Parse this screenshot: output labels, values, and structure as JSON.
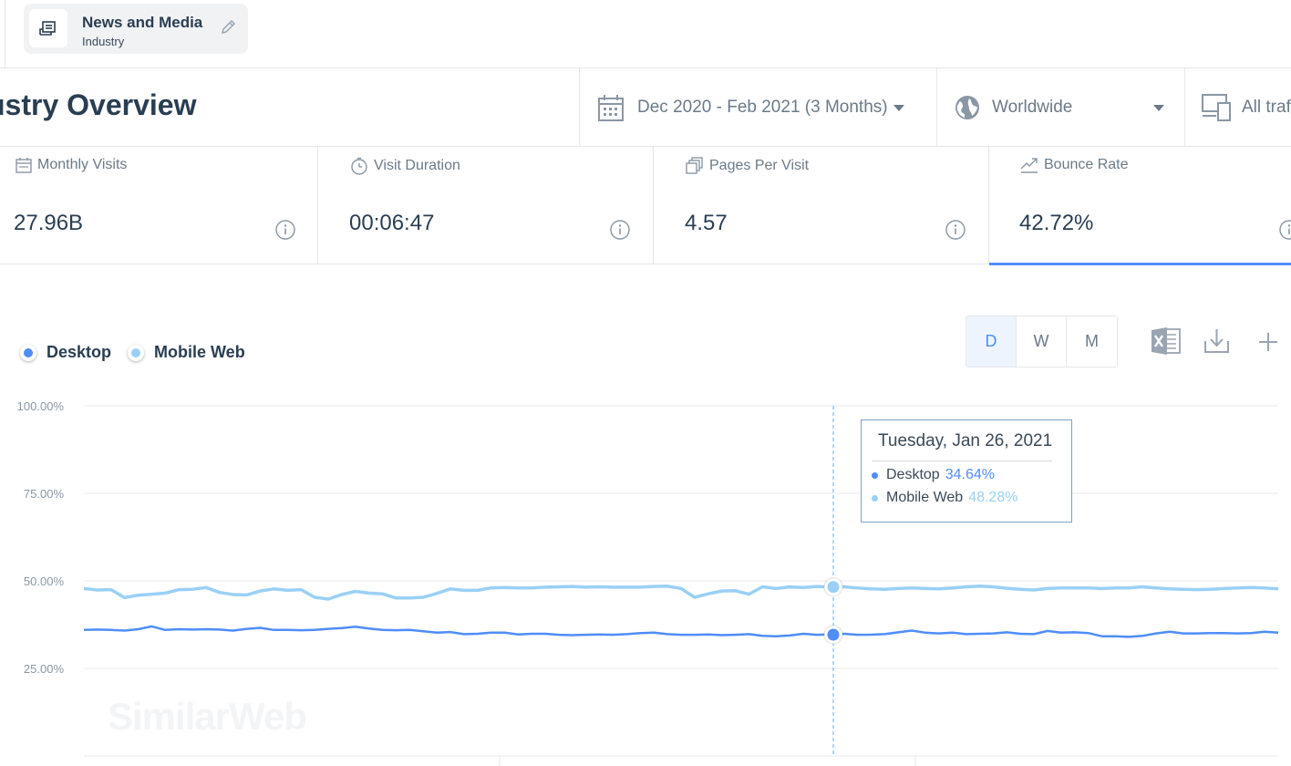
{
  "industry_chip": {
    "title": "News and Media",
    "subtitle": "Industry"
  },
  "header": {
    "title": "ustry Overview",
    "date_range": "Dec 2020 - Feb 2021 (3 Months)",
    "country": "Worldwide",
    "traffic": "All traf"
  },
  "metrics": [
    {
      "label": "Monthly Visits",
      "value": "27.96B",
      "icon": "calendar-icon"
    },
    {
      "label": "Visit Duration",
      "value": "00:06:47",
      "icon": "stopwatch-icon"
    },
    {
      "label": "Pages Per Visit",
      "value": "4.57",
      "icon": "pages-icon"
    },
    {
      "label": "Bounce Rate",
      "value": "42.72%",
      "icon": "bounce-icon"
    }
  ],
  "legend": {
    "desktop": "Desktop",
    "mobile": "Mobile Web"
  },
  "granularity": [
    "D",
    "W",
    "M"
  ],
  "granularity_selected": "D",
  "colors": {
    "accent": "#4f8df9",
    "desktop": "#4f8df9",
    "mobile": "#9ad0f5"
  },
  "tooltip": {
    "date": "Tuesday, Jan 26, 2021",
    "desktop_label": "Desktop",
    "desktop_value": "34.64%",
    "mobile_label": "Mobile Web",
    "mobile_value": "48.28%"
  },
  "watermark": "SimilarWeb",
  "chart_data": {
    "type": "line",
    "yticks": [
      "100.00%",
      "75.00%",
      "50.00%",
      "25.00%"
    ],
    "ylim": [
      0,
      100
    ],
    "hover_index": 70,
    "series": [
      {
        "name": "Desktop",
        "values": [
          36.0,
          36.1,
          36.0,
          35.8,
          36.2,
          37.0,
          36.0,
          36.2,
          36.1,
          36.2,
          36.1,
          35.8,
          36.3,
          36.6,
          36.0,
          36.0,
          35.9,
          36.0,
          36.3,
          36.5,
          36.9,
          36.4,
          36.0,
          35.9,
          36.0,
          35.6,
          35.2,
          35.4,
          34.8,
          34.9,
          35.2,
          35.2,
          34.7,
          34.9,
          34.9,
          34.6,
          34.5,
          34.6,
          34.7,
          34.6,
          34.8,
          35.1,
          35.2,
          34.8,
          34.6,
          34.6,
          34.7,
          34.5,
          34.6,
          34.8,
          34.3,
          34.2,
          34.4,
          34.9,
          34.6,
          34.7,
          34.9,
          34.6,
          34.64,
          34.8,
          35.3,
          35.8,
          35.2,
          35.0,
          35.2,
          34.8,
          34.9,
          35.0,
          35.3,
          34.9,
          34.8,
          35.7,
          35.2,
          35.3,
          35.1,
          34.2,
          34.2,
          34.0,
          34.3,
          35.0,
          35.5,
          35.0,
          35.0,
          35.1,
          35.1,
          35.0,
          35.1,
          35.5,
          35.2
        ],
        "note_values_reading_order": "left-to-right daily values"
      },
      {
        "name": "Mobile Web",
        "values": [
          47.8,
          47.4,
          47.5,
          45.2,
          45.9,
          46.2,
          46.5,
          47.5,
          47.6,
          48.1,
          46.7,
          46.1,
          46.0,
          47.1,
          47.7,
          47.3,
          47.5,
          45.3,
          44.8,
          46.1,
          47.0,
          46.5,
          46.3,
          45.1,
          45.1,
          45.3,
          46.4,
          47.7,
          47.3,
          47.3,
          48.0,
          48.1,
          48.0,
          48.0,
          48.2,
          48.3,
          48.4,
          48.2,
          48.3,
          48.2,
          48.2,
          48.2,
          48.4,
          48.5,
          47.8,
          45.3,
          46.3,
          47.1,
          47.2,
          46.2,
          48.3,
          47.8,
          48.28,
          48.1,
          48.4,
          48.2,
          48.3,
          48.0,
          47.7,
          47.6,
          47.8,
          48.0,
          47.8,
          47.7,
          48.0,
          48.3,
          48.5,
          48.3,
          47.9,
          47.6,
          47.4,
          47.8,
          48.0,
          48.0,
          48.0,
          47.8,
          48.0,
          48.0,
          48.3,
          48.0,
          47.7,
          47.6,
          47.5,
          47.6,
          47.8,
          48.0,
          48.1,
          48.0,
          47.7
        ]
      }
    ]
  }
}
